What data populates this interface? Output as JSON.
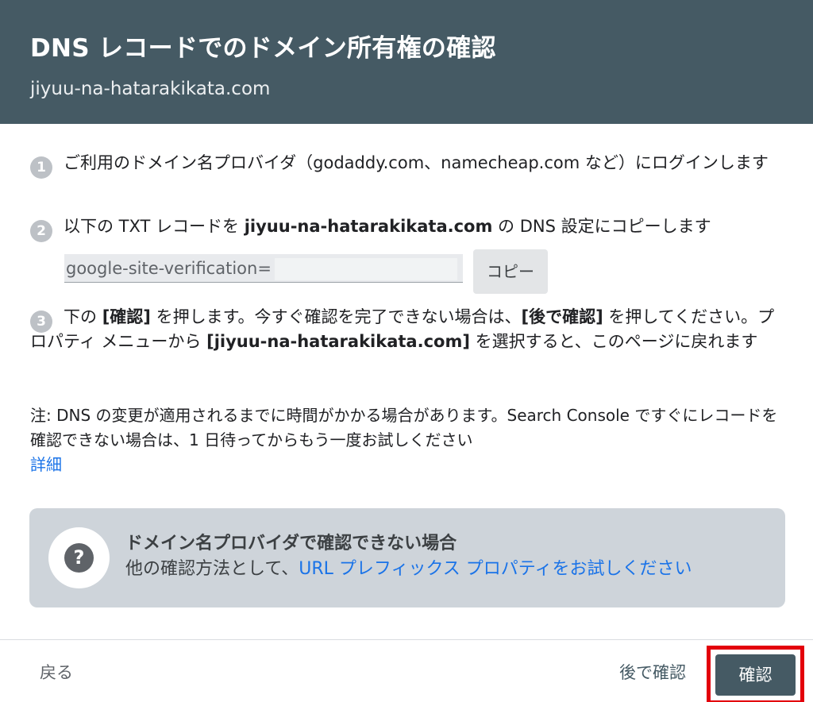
{
  "header": {
    "title": "DNS レコードでのドメイン所有権の確認",
    "subtitle": "jiyuu-na-hatarakikata.com"
  },
  "steps": [
    {
      "number": "1",
      "text": "ご利用のドメイン名プロバイダ（godaddy.com、namecheap.com など）にログインします"
    },
    {
      "number": "2",
      "text_before": "以下の TXT レコードを ",
      "domain": "jiyuu-na-hatarakikata.com",
      "text_after": " の DNS 設定にコピーします"
    },
    {
      "number": "3",
      "part1": "下の ",
      "bracket1": "[確認]",
      "part2": " を押します。今すぐ確認を完了できない場合は、",
      "bracket2": "[後で確認]",
      "part3": " を押してください。プロパティ メニューから ",
      "bracket3": "[jiyuu-na-hatarakikata.com]",
      "part4": " を選択すると、このページに戻れます"
    }
  ],
  "record": {
    "value": "google-site-verification=",
    "copy_label": "コピー"
  },
  "note": {
    "text": "注: DNS の変更が適用されるまでに時間がかかる場合があります。Search Console ですぐにレコードを確認できない場合は、1 日待ってからもう一度お試しください",
    "details_link": "詳細"
  },
  "infobox": {
    "icon": "question-icon",
    "icon_glyph": "?",
    "title": "ドメイン名プロバイダで確認できない場合",
    "subtitle_before": "他の確認方法として、",
    "subtitle_link": "URL プレフィックス プロパティをお試しください"
  },
  "footer": {
    "back_label": "戻る",
    "later_label": "後で確認",
    "verify_label": "確認"
  },
  "colors": {
    "header_bg": "#455a64",
    "link": "#1a73e8",
    "highlight_border": "#e3000b",
    "infobox_bg": "#ced4da"
  }
}
